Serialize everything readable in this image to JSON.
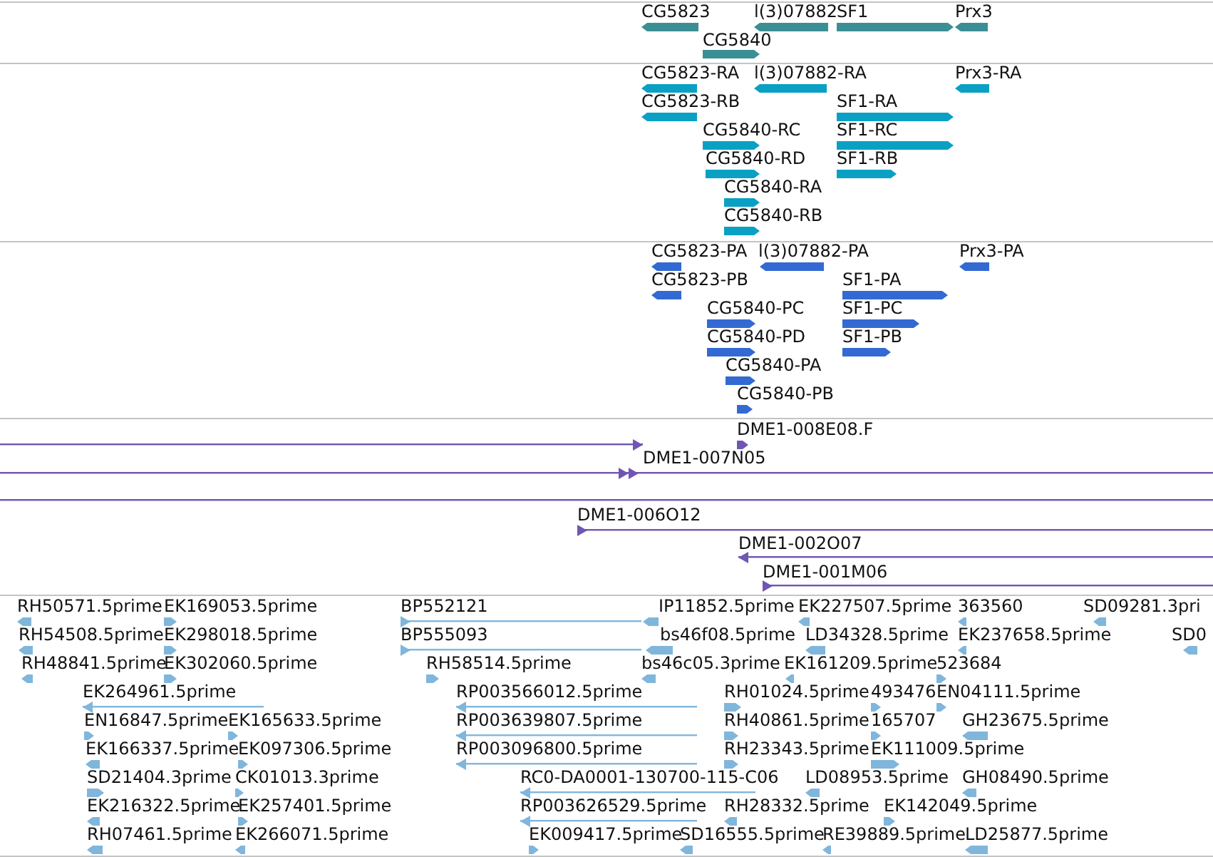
{
  "tracks": [
    {
      "color": "#3b8f94",
      "features": [
        {
          "label": "CG5823",
          "reverse": true
        },
        {
          "label": "l(3)07882",
          "reverse": true
        },
        {
          "label": "SF1",
          "reverse": false
        },
        {
          "label": "Prx3",
          "reverse": true
        },
        {
          "label": "CG5840",
          "reverse": false
        }
      ]
    },
    {
      "color": "#0aa0c4",
      "features": [
        {
          "label": "CG5823-RA",
          "reverse": true
        },
        {
          "label": "l(3)07882-RA",
          "reverse": true
        },
        {
          "label": "Prx3-RA",
          "reverse": true
        },
        {
          "label": "CG5823-RB",
          "reverse": true
        },
        {
          "label": "SF1-RA",
          "reverse": false
        },
        {
          "label": "CG5840-RC",
          "reverse": false
        },
        {
          "label": "SF1-RC",
          "reverse": false
        },
        {
          "label": "CG5840-RD",
          "reverse": false
        },
        {
          "label": "SF1-RB",
          "reverse": false
        },
        {
          "label": "CG5840-RA",
          "reverse": false
        },
        {
          "label": "CG5840-RB",
          "reverse": false
        }
      ]
    },
    {
      "color": "#3369d2",
      "features": [
        {
          "label": "CG5823-PA",
          "reverse": true
        },
        {
          "label": "l(3)07882-PA",
          "reverse": true
        },
        {
          "label": "Prx3-PA",
          "reverse": true
        },
        {
          "label": "CG5823-PB",
          "reverse": true
        },
        {
          "label": "SF1-PA",
          "reverse": false
        },
        {
          "label": "CG5840-PC",
          "reverse": false
        },
        {
          "label": "SF1-PC",
          "reverse": false
        },
        {
          "label": "CG5840-PD",
          "reverse": false
        },
        {
          "label": "SF1-PB",
          "reverse": false
        },
        {
          "label": "CG5840-PA",
          "reverse": false
        },
        {
          "label": "CG5840-PB",
          "reverse": false
        }
      ]
    },
    {
      "color": "#7056b2",
      "features": [
        {
          "kind": "arrow",
          "reverse": false
        },
        {
          "kind": "arrow",
          "label": "DME1-008E08.F",
          "reverse": false
        },
        {
          "kind": "arrow",
          "reverse": false
        },
        {
          "kind": "arrow",
          "label": "DME1-007N05",
          "reverse": false
        },
        {
          "kind": "span"
        },
        {
          "kind": "arrow",
          "label": "DME1-006O12",
          "reverse": false
        },
        {
          "kind": "arrow",
          "label": "DME1-002O07",
          "reverse": true
        },
        {
          "kind": "arrow",
          "label": "DME1-001M06",
          "reverse": false
        }
      ]
    },
    {
      "color": "#80b6dc",
      "features": [
        {
          "label": "RH50571.5prime",
          "reverse": true
        },
        {
          "label": "EK169053.5prime",
          "reverse": false
        },
        {
          "label": "BP552121",
          "reverse": false
        },
        {
          "label": "IP11852.5prime",
          "reverse": true
        },
        {
          "label": "EK227507.5prime",
          "reverse": true
        },
        {
          "label": "363560",
          "reverse": true
        },
        {
          "label": "SD09281.3pri",
          "reverse": true
        },
        {
          "label": "RH54508.5prime",
          "reverse": true
        },
        {
          "label": "EK298018.5prime",
          "reverse": false
        },
        {
          "label": "BP555093",
          "reverse": false
        },
        {
          "label": "bs46f08.5prime",
          "reverse": true
        },
        {
          "label": "LD34328.5prime",
          "reverse": true
        },
        {
          "label": "EK237658.5prime",
          "reverse": true
        },
        {
          "label": "SD0",
          "reverse": true
        },
        {
          "label": "RH48841.5prime",
          "reverse": true
        },
        {
          "label": "EK302060.5prime",
          "reverse": false
        },
        {
          "label": "RH58514.5prime",
          "reverse": false
        },
        {
          "label": "bs46c05.3prime",
          "reverse": true
        },
        {
          "label": "EK161209.5prime",
          "reverse": true
        },
        {
          "label": "523684",
          "reverse": false
        },
        {
          "label": "EK264961.5prime",
          "reverse": true
        },
        {
          "label": "RP003566012.5prime",
          "reverse": true
        },
        {
          "label": "RH01024.5prime",
          "reverse": false
        },
        {
          "label": "493476",
          "reverse": false
        },
        {
          "label": "EN04111.5prime",
          "reverse": false
        },
        {
          "label": "EN16847.5prime",
          "reverse": false
        },
        {
          "label": "EK165633.5prime",
          "reverse": false
        },
        {
          "label": "RP003639807.5prime",
          "reverse": true
        },
        {
          "label": "RH40861.5prime",
          "reverse": false
        },
        {
          "label": "165707",
          "reverse": false
        },
        {
          "label": "GH23675.5prime",
          "reverse": true
        },
        {
          "label": "EK166337.5prime",
          "reverse": true
        },
        {
          "label": "EK097306.5prime",
          "reverse": false
        },
        {
          "label": "RP003096800.5prime",
          "reverse": true
        },
        {
          "label": "RH23343.5prime",
          "reverse": false
        },
        {
          "label": "EK111009.5prime",
          "reverse": false
        },
        {
          "label": "SD21404.3prime",
          "reverse": false
        },
        {
          "label": "CK01013.3prime",
          "reverse": false
        },
        {
          "label": "RC0-DA0001-130700-115-C06",
          "reverse": true
        },
        {
          "label": "LD08953.5prime",
          "reverse": true
        },
        {
          "label": "GH08490.5prime",
          "reverse": true
        },
        {
          "label": "EK216322.5prime",
          "reverse": true
        },
        {
          "label": "EK257401.5prime",
          "reverse": false
        },
        {
          "label": "RP003626529.5prime",
          "reverse": true
        },
        {
          "label": "RH28332.5prime",
          "reverse": true
        },
        {
          "label": "EK142049.5prime",
          "reverse": false
        },
        {
          "label": "RH07461.5prime",
          "reverse": true
        },
        {
          "label": "EK266071.5prime",
          "reverse": true
        },
        {
          "label": "EK009417.5prime",
          "reverse": false
        },
        {
          "label": "SD16555.5prime",
          "reverse": true
        },
        {
          "label": "RE39889.5prime",
          "reverse": true
        },
        {
          "label": "LD25877.5prime",
          "reverse": true
        }
      ]
    }
  ]
}
